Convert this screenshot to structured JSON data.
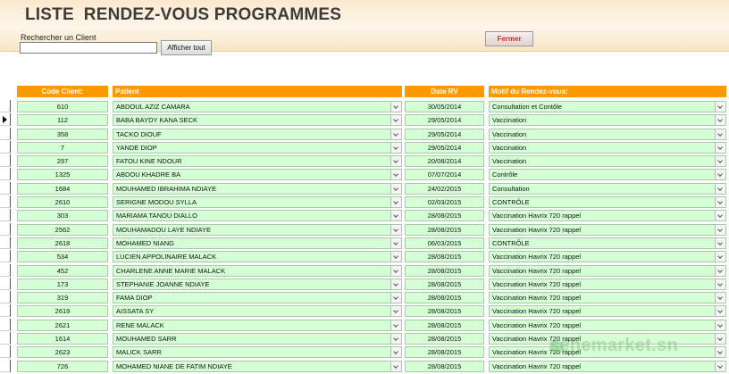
{
  "form": {
    "title": "LISTE  RENDEZ-VOUS PROGRAMMES",
    "search_label": "Rechercher un Client",
    "search_value": "",
    "show_all_label": "Afficher tout",
    "close_label": "Fermer"
  },
  "columns": {
    "code": "Code Client:",
    "patient": "Patient",
    "date": "Date RV",
    "motif": "Motif du Rendez-vous:"
  },
  "colors": {
    "header": "#ff9900",
    "cell": "#d5ffd5"
  },
  "rows": [
    {
      "code": "610",
      "patient": "ABDOUL AZIZ CAMARA",
      "date": "30/05/2014",
      "motif": "Consultation et Contôle"
    },
    {
      "code": "112",
      "patient": "BABA BAYDY KANA SECK",
      "date": "29/05/2014",
      "motif": "Vaccination"
    },
    {
      "code": "358",
      "patient": "TACKO DIOUF",
      "date": "29/05/2014",
      "motif": "Vaccination"
    },
    {
      "code": "7",
      "patient": "YANDE DIOP",
      "date": "29/05/2014",
      "motif": "Vaccination"
    },
    {
      "code": "297",
      "patient": "FATOU KINE NDOUR",
      "date": "20/08/2014",
      "motif": "Vaccination"
    },
    {
      "code": "1325",
      "patient": "ABDOU KHADRE BA",
      "date": "07/07/2014",
      "motif": "Contrôle"
    },
    {
      "code": "1684",
      "patient": "MOUHAMED IBRAHIMA NDIAYE",
      "date": "24/02/2015",
      "motif": "Consultation"
    },
    {
      "code": "2610",
      "patient": "SERIGNE MODOU SYLLA",
      "date": "02/03/2015",
      "motif": "CONTRÔLE"
    },
    {
      "code": "303",
      "patient": "MARIAMA TANOU DIALLO",
      "date": "28/08/2015",
      "motif": "Vaccination Havrix 720 rappel"
    },
    {
      "code": "2562",
      "patient": "MOUHAMADOU LAYE NDIAYE",
      "date": "28/08/2015",
      "motif": "Vaccination Havrix 720 rappel"
    },
    {
      "code": "2618",
      "patient": "MOHAMED NIANG",
      "date": "06/03/2015",
      "motif": "CONTRÔLE"
    },
    {
      "code": "534",
      "patient": "LUCIEN APPOLINAIRE MALACK",
      "date": "28/08/2015",
      "motif": "Vaccination Havrix 720 rappel"
    },
    {
      "code": "452",
      "patient": "CHARLENE ANNE MARIE MALACK",
      "date": "28/08/2015",
      "motif": "Vaccination Havrix 720 rappel"
    },
    {
      "code": "173",
      "patient": "STEPHANIE JOANNE NDIAYE",
      "date": "28/08/2015",
      "motif": "Vaccination Havrix 720 rappel"
    },
    {
      "code": "319",
      "patient": "FAMA DIOP",
      "date": "28/08/2015",
      "motif": "Vaccination Havrix 720 rappel"
    },
    {
      "code": "2619",
      "patient": "AISSATA SY",
      "date": "28/08/2015",
      "motif": "Vaccination Havrix 720 rappel"
    },
    {
      "code": "2621",
      "patient": "RENE MALACK",
      "date": "28/08/2015",
      "motif": "Vaccination Havrix 720 rappel"
    },
    {
      "code": "1614",
      "patient": "MOUHAMED SARR",
      "date": "28/08/2015",
      "motif": "Vaccination Havrix 720 rappel"
    },
    {
      "code": "2623",
      "patient": "MALICK SARR",
      "date": "28/08/2015",
      "motif": "Vaccination Havrix 720 rappel"
    },
    {
      "code": "726",
      "patient": "MOHAMED NIANE  DE FATIM NDIAYE",
      "date": "28/08/2015",
      "motif": "Vaccination Havrix 720 rappel"
    }
  ],
  "current_row": 1,
  "watermark": "senemarket.sn"
}
